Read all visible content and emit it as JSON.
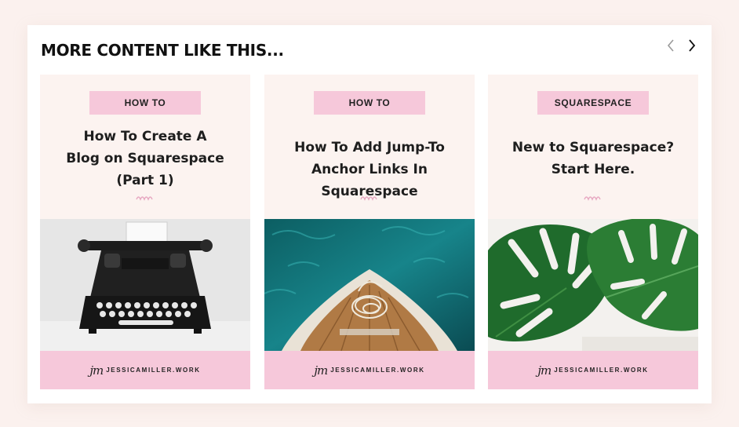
{
  "section": {
    "title": "MORE CONTENT LIKE THIS..."
  },
  "nav": {
    "prev_icon": "chevron-left-icon",
    "next_icon": "chevron-right-icon"
  },
  "colors": {
    "background": "#fbf1ee",
    "tag_pink": "#f6c8da",
    "card_bg": "#fcf3f0"
  },
  "cards": [
    {
      "tag": "HOW TO",
      "title_lines": [
        "How To Create A",
        "Blog on Squarespace",
        "(Part 1)"
      ],
      "image": "typewriter-photo",
      "logo": "jm",
      "site": "JESSICAMILLER.WORK"
    },
    {
      "tag": "HOW TO",
      "title_lines": [
        "How To Add Jump-To",
        "Anchor Links In Squarespace"
      ],
      "image": "boat-on-water-photo",
      "logo": "jm",
      "site": "JESSICAMILLER.WORK"
    },
    {
      "tag": "SQUARESPACE",
      "title_lines": [
        "New to Squarespace?",
        "Start Here."
      ],
      "image": "monstera-leaf-photo",
      "logo": "jm",
      "site": "JESSICAMILLER.WORK"
    }
  ]
}
